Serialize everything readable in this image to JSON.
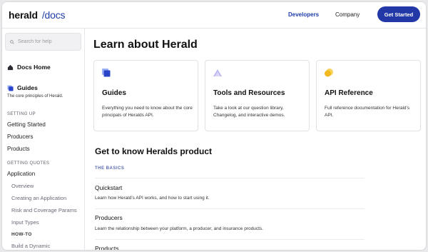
{
  "header": {
    "logo_brand": "herald",
    "logo_suffix": "/docs",
    "nav": {
      "developers": "Developers",
      "company": "Company"
    },
    "cta": "Get Started"
  },
  "sidebar": {
    "search_placeholder": "Search for help",
    "docs_home": "Docs Home",
    "guides": "Guides",
    "guides_desc": "The core principles of Herald.",
    "section_setting_up": "SETTING UP",
    "getting_started": "Getting Started",
    "producers": "Producers",
    "products": "Products",
    "section_getting_quotes": "GETTING QUOTES",
    "application": "Application",
    "overview": "Overview",
    "creating_application": "Creating an Application",
    "risk_coverage": "Risk and Coverage Params",
    "input_types": "Input Types",
    "how_to": "HOW-TO",
    "build_dynamic": "Build a Dynamic"
  },
  "main": {
    "title": "Learn about Herald",
    "cards": [
      {
        "title": "Guides",
        "desc": "Everything you need to know about the core principals of Heralds API.",
        "icon": "guides-icon",
        "color": "#2b45c8"
      },
      {
        "title": "Tools and Resources",
        "desc": "Take a look at our question library, Changelog, and interactive demos.",
        "icon": "tools-icon",
        "color": "#b9b5ef"
      },
      {
        "title": "API Reference",
        "desc": "Full reference documentation for Herald’s API.",
        "icon": "api-icon",
        "color": "#f2b81d"
      }
    ],
    "section_title": "Get to know Heralds product",
    "basics_label": "THE BASICS",
    "rows": [
      {
        "title": "Quickstart",
        "desc": "Learn how Herald’s API works, and how to start using it."
      },
      {
        "title": "Producers",
        "desc": "Learn the relationship between your platform, a producer, and insurance products."
      },
      {
        "title": "Products",
        "desc": ""
      }
    ]
  },
  "colors": {
    "accent": "#2238a6",
    "link": "#1f3da8"
  }
}
